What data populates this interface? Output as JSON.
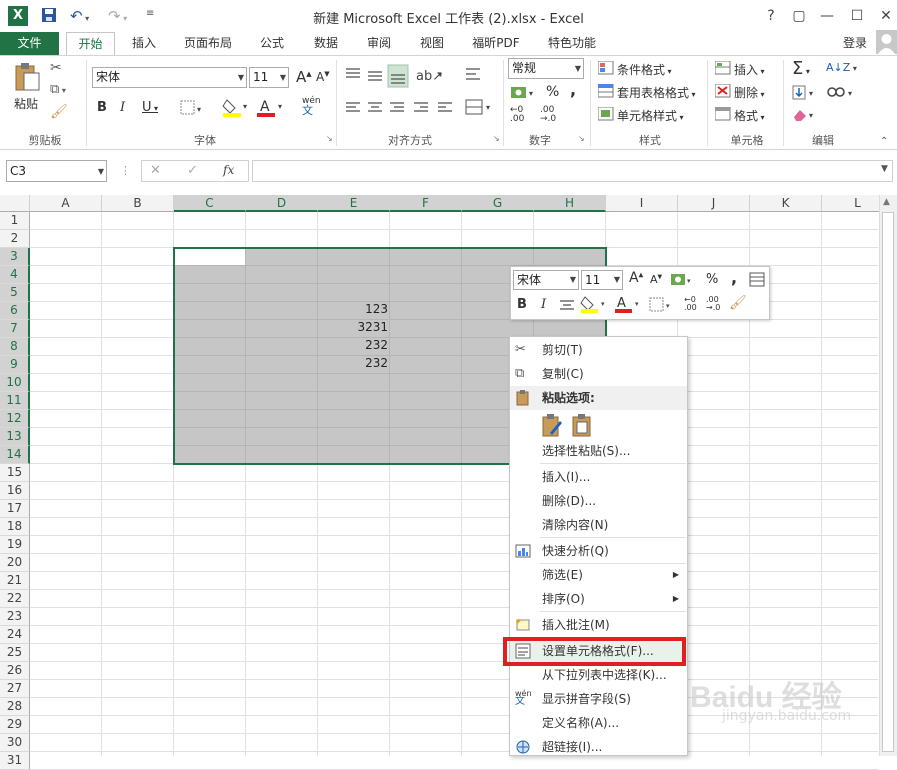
{
  "title": "新建 Microsoft Excel 工作表 (2).xlsx - Excel",
  "window": {
    "help": "?",
    "restore": "▢",
    "minimize": "—",
    "maximize": "☐",
    "close": "✕"
  },
  "tabs": [
    "文件",
    "开始",
    "插入",
    "页面布局",
    "公式",
    "数据",
    "审阅",
    "视图",
    "福昕PDF",
    "特色功能"
  ],
  "login": "登录",
  "ribbon": {
    "clipboard": {
      "paste": "粘贴",
      "label": "剪贴板"
    },
    "font": {
      "name": "宋体",
      "size": "11",
      "label": "字体",
      "bold": "B",
      "italic": "I",
      "underline": "U",
      "grow": "A",
      "shrink": "A",
      "phonetic": "wén"
    },
    "alignment": {
      "label": "对齐方式"
    },
    "number": {
      "format": "常规",
      "percent": "%",
      "comma": ",",
      "label": "数字"
    },
    "styles": {
      "conditional": "条件格式",
      "table": "套用表格格式",
      "cell": "单元格样式",
      "label": "样式"
    },
    "cells": {
      "insert": "插入",
      "delete": "删除",
      "format": "格式",
      "label": "单元格"
    },
    "editing": {
      "label": "编辑"
    }
  },
  "formula": {
    "namebox": "C3",
    "fx": "fx",
    "cancel": "✕",
    "enter": "✓"
  },
  "columns": [
    "A",
    "B",
    "C",
    "D",
    "E",
    "F",
    "G",
    "H",
    "I",
    "J",
    "K",
    "L"
  ],
  "rows": [
    "1",
    "2",
    "3",
    "4",
    "5",
    "6",
    "7",
    "8",
    "9",
    "10",
    "11",
    "12",
    "13",
    "14",
    "15",
    "16",
    "17",
    "18",
    "19",
    "20",
    "21",
    "22",
    "23",
    "24",
    "25",
    "26",
    "27",
    "28",
    "29",
    "30",
    "31"
  ],
  "cells": {
    "E6": "123",
    "E7": "3231",
    "E8": "232",
    "E9": "232"
  },
  "mini": {
    "font": "宋体",
    "size": "11",
    "bold": "B",
    "italic": "I",
    "percent": "%",
    "comma": ","
  },
  "context_menu": {
    "cut": "剪切(T)",
    "copy": "复制(C)",
    "paste_options": "粘贴选项:",
    "paste_special": "选择性粘贴(S)...",
    "insert": "插入(I)...",
    "delete": "删除(D)...",
    "clear": "清除内容(N)",
    "quick_analysis": "快速分析(Q)",
    "filter": "筛选(E)",
    "sort": "排序(O)",
    "insert_comment": "插入批注(M)",
    "format_cells": "设置单元格格式(F)...",
    "pick_list": "从下拉列表中选择(K)...",
    "phonetic": "显示拼音字段(S)",
    "define_name": "定义名称(A)...",
    "hyperlink": "超链接(I)..."
  },
  "watermark": "Baidu 经验",
  "watermark_url": "jingyan.baidu.com",
  "colors": {
    "excel_green": "#217346",
    "selection_fill": "#c6c6c6",
    "highlight_red": "#e02020"
  }
}
